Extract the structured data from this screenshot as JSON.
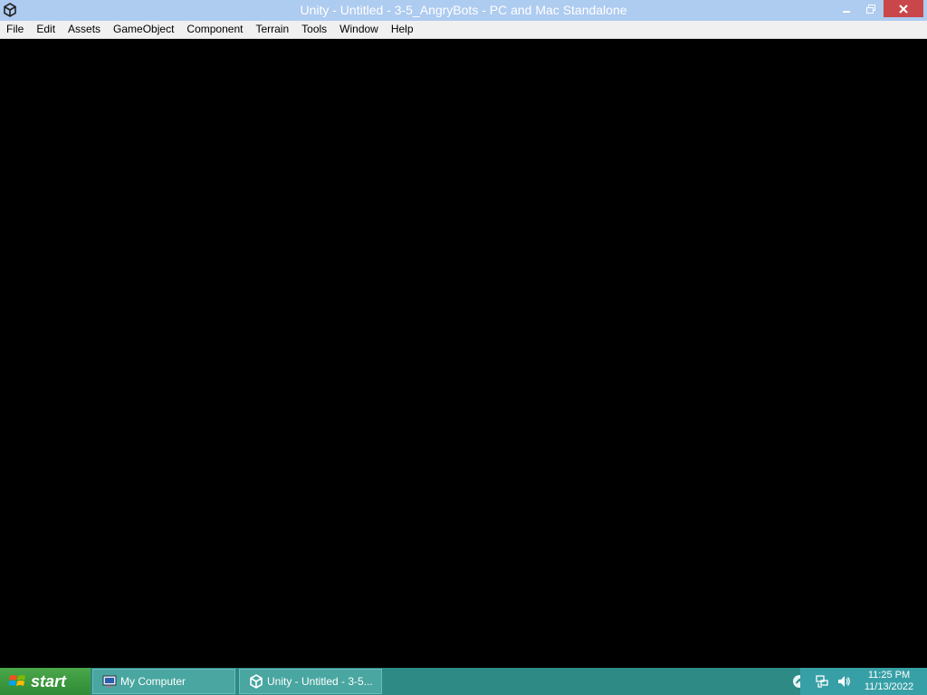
{
  "window": {
    "title": "Unity - Untitled - 3-5_AngryBots - PC and Mac Standalone",
    "app_icon": "unity-icon",
    "controls": [
      "minimize-icon",
      "restore-icon",
      "close-icon"
    ]
  },
  "menu": {
    "items": [
      "File",
      "Edit",
      "Assets",
      "GameObject",
      "Component",
      "Terrain",
      "Tools",
      "Window",
      "Help"
    ]
  },
  "taskbar": {
    "start_label": "start",
    "tasks": [
      {
        "label": "My Computer",
        "icon": "computer-icon"
      },
      {
        "label": "Unity - Untitled - 3-5...",
        "icon": "unity-icon"
      }
    ],
    "tray": {
      "icons": [
        "chevron-up-icon",
        "network-icon",
        "volume-icon"
      ],
      "time": "11:25 PM",
      "date": "11/13/2022"
    }
  },
  "colors": {
    "titlebar": "#aecbf0",
    "close_button": "#c9464a",
    "taskbar": "#2d8a84",
    "start_button": "#3b9a3f"
  }
}
